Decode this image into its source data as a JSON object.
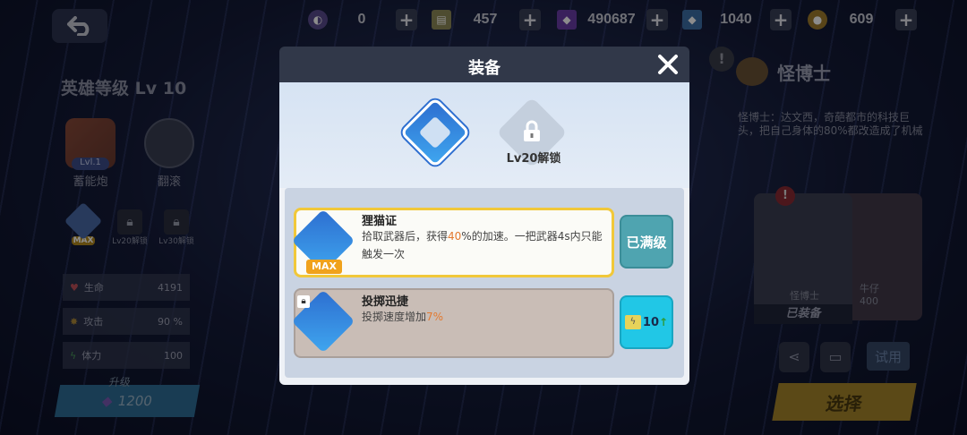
{
  "resources": [
    {
      "icon": "purple-orb-icon",
      "value": "0"
    },
    {
      "icon": "ticket-icon",
      "value": "457"
    },
    {
      "icon": "purple-gem-icon",
      "value": "490687"
    },
    {
      "icon": "blue-gem-icon",
      "value": "1040"
    },
    {
      "icon": "gold-coin-icon",
      "value": "609"
    }
  ],
  "left": {
    "hero_level": "英雄等级 Lv 10",
    "skills": [
      {
        "name": "蓄能炮",
        "badge": "Lvl.1"
      },
      {
        "name": "翻滚"
      }
    ],
    "small_skills": [
      {
        "badge": "MAX"
      },
      {
        "label": "Lv20解锁"
      },
      {
        "label": "Lv30解锁"
      }
    ],
    "stats": [
      {
        "label": "生命",
        "value": "4191",
        "icon": "heart-icon"
      },
      {
        "label": "攻击",
        "value": "90 %",
        "icon": "attack-icon"
      },
      {
        "label": "体力",
        "value": "100",
        "icon": "lightning-icon"
      }
    ],
    "upgrade_label": "升级",
    "upgrade_cost": "1200"
  },
  "right": {
    "name": "怪博士",
    "description": "怪博士：达文西，奇葩都市的科技巨头，把自己身体的80%都改造成了机械",
    "card_name": "怪博士",
    "card_name2": "牛仔",
    "card_value": "400",
    "equipped_label": "已装备",
    "try_label": "试用",
    "select_label": "选择"
  },
  "modal": {
    "title": "装备",
    "slot2_lock_label": "Lv20解锁",
    "items": [
      {
        "title": "狸猫证",
        "desc_a": "拾取武器后，获得",
        "desc_hl": "40",
        "desc_b": "%的加速。一把武器4s内只能触发一次",
        "badge": "MAX",
        "action_label": "已满级"
      },
      {
        "title": "投掷迅捷",
        "desc_a": "投掷速度增加",
        "desc_hl": "7%",
        "cost_value": "10"
      }
    ]
  },
  "colors": {
    "accent_orange": "#e3792f",
    "maxed_teal": "#4fa4b0",
    "cost_cyan": "#21c7e6"
  }
}
